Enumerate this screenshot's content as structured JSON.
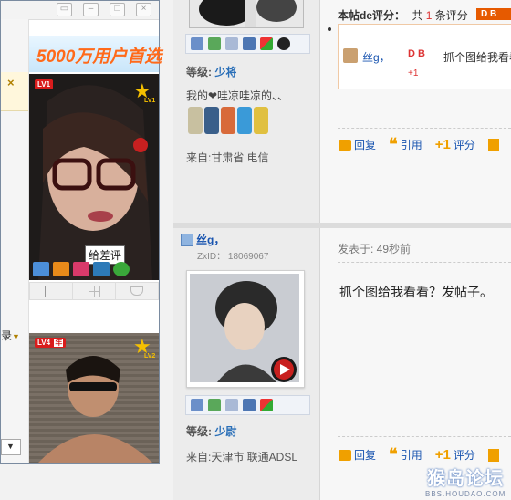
{
  "post1": {
    "rating_title": "本帖de评分：",
    "rating_total_prefix": "共",
    "rating_total_count": "1",
    "rating_total_suffix": "条评分",
    "rating_user": "丝g，",
    "rating_points_a": "D B",
    "rating_points_b": "+1",
    "rating_reason": "抓个图给我看看",
    "level_label": "等级:",
    "level_value": "少将",
    "signature": "我的❤哇凉哇凉的、、",
    "from": "来自:甘肃省 电信",
    "actions": {
      "reply": "回复",
      "quote": "引用",
      "rate": "评分"
    }
  },
  "post2": {
    "author": "丝g，",
    "zxid": "ZxID：  18069067",
    "posted_time": "发表于: 49秒前",
    "content": "抓个图给我看看？发帖子。",
    "level_label": "等级:",
    "level_value": "少尉",
    "from": "来自:天津市 联通ADSL",
    "actions": {
      "reply": "回复",
      "quote": "引用",
      "rate": "评分"
    }
  },
  "popup": {
    "ad_text": "5000万用户首选",
    "card1_lv": "LV1",
    "card1_badge": "LV1",
    "tooltip": "给差评",
    "card2_lv": "LV4",
    "card2_badge": "LV2",
    "card2_tag": "年"
  },
  "left_edge": {
    "dropdown_text": "录"
  },
  "watermark": {
    "title": "猴岛论坛",
    "url": "BBS.HOUDAO.COM"
  },
  "colors": {
    "link_blue": "#1a55b0",
    "accent_orange": "#f0a000",
    "rating_red": "#d33"
  }
}
